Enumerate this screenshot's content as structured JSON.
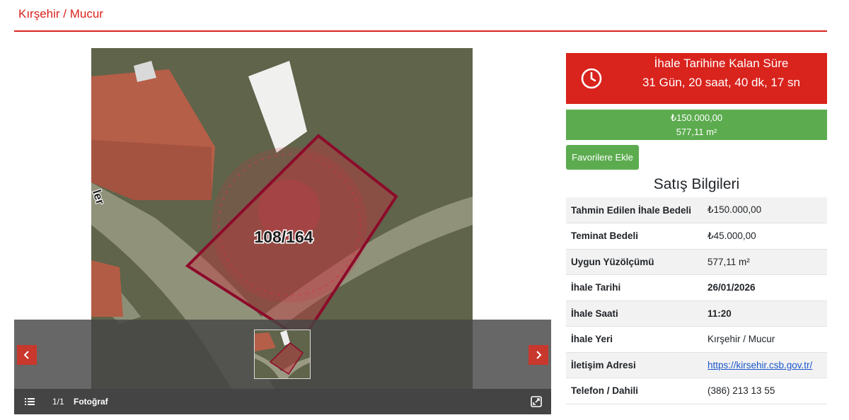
{
  "header": {
    "title": "Kırşehir / Mucur"
  },
  "gallery": {
    "parcel_label": "108/164",
    "counter": "1/1",
    "label": "Fotoğraf",
    "street_label": "ler"
  },
  "countdown": {
    "label": "İhale Tarihine Kalan Süre",
    "value": "31 Gün, 20 saat, 40 dk, 17 sn"
  },
  "price_box": {
    "price": "₺150.000,00",
    "area": "577,11 m²"
  },
  "favorite_button": "Favorilere Ekle",
  "sale_info": {
    "title": "Satış Bilgileri",
    "rows": [
      {
        "key": "Tahmin Edilen İhale Bedeli",
        "value": "₺150.000,00"
      },
      {
        "key": "Teminat Bedeli",
        "value": "₺45.000,00"
      },
      {
        "key": "Uygun Yüzölçümü",
        "value": "577,11 m²"
      },
      {
        "key": "İhale Tarihi",
        "value": "26/01/2026"
      },
      {
        "key": "İhale Saati",
        "value": "11:20"
      },
      {
        "key": "İhale Yeri",
        "value": "Kırşehir / Mucur"
      },
      {
        "key": "İletişim Adresi",
        "value": "https://kirsehir.csb.gov.tr/"
      },
      {
        "key": "Telefon / Dahili",
        "value": "(386) 213 13 55"
      }
    ]
  },
  "colors": {
    "accent_red": "#d9231d",
    "accent_green": "#5cac4f",
    "link_blue": "#1a57c9"
  }
}
